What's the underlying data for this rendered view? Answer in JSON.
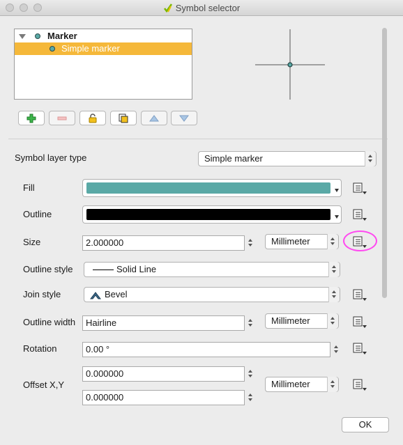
{
  "window": {
    "title": "Symbol selector"
  },
  "tree": {
    "items": [
      {
        "label": "Marker",
        "expanded": true
      },
      {
        "label": "Simple marker",
        "selected": true
      }
    ]
  },
  "toolbar": {
    "buttons": [
      {
        "name": "add-layer",
        "icon": "plus-icon"
      },
      {
        "name": "remove-layer",
        "icon": "minus-icon"
      },
      {
        "name": "lock-layer",
        "icon": "lock-icon"
      },
      {
        "name": "duplicate-layer",
        "icon": "duplicate-icon"
      },
      {
        "name": "move-up",
        "icon": "arrow-up-icon"
      },
      {
        "name": "move-down",
        "icon": "arrow-down-icon"
      }
    ]
  },
  "symbol_layer_type": {
    "label": "Symbol layer type",
    "value": "Simple marker"
  },
  "properties": {
    "fill": {
      "label": "Fill",
      "color": "#5aa9a6"
    },
    "outline": {
      "label": "Outline",
      "color": "#000000"
    },
    "size": {
      "label": "Size",
      "value": "2.000000",
      "unit": "Millimeter"
    },
    "outline_style": {
      "label": "Outline style",
      "value": "Solid Line"
    },
    "join_style": {
      "label": "Join style",
      "value": "Bevel"
    },
    "outline_width": {
      "label": "Outline width",
      "value": "Hairline",
      "unit": "Millimeter"
    },
    "rotation": {
      "label": "Rotation",
      "value": "0.00 °"
    },
    "offset": {
      "label": "Offset X,Y",
      "x": "0.000000",
      "y": "0.000000",
      "unit": "Millimeter"
    }
  },
  "ok_label": "OK",
  "colors": {
    "selection": "#f5b83a",
    "highlight_ring": "#ff4af0"
  }
}
